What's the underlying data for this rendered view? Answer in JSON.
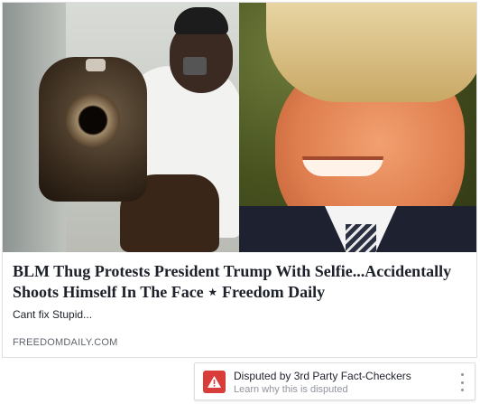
{
  "link_preview": {
    "title": "BLM Thug Protests President Trump With Selfie...Accidentally Shoots Himself In The Face ⋆ Freedom Daily",
    "description": "Cant fix Stupid...",
    "domain": "FREEDOMDAILY.COM"
  },
  "dispute_notice": {
    "title": "Disputed by 3rd Party Fact-Checkers",
    "subtitle": "Learn why this is disputed",
    "icon": "warning-icon",
    "accent_color": "#d93d3a"
  },
  "menu": {
    "icon": "more-options-icon"
  }
}
